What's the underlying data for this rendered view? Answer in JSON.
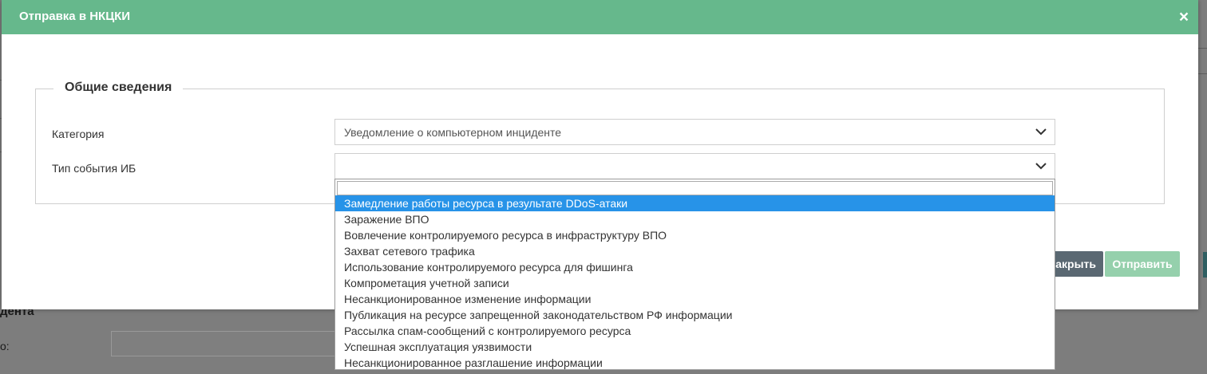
{
  "background": {
    "heading": "дента",
    "label": "о:"
  },
  "modal": {
    "title": "Отправка в НКЦКИ",
    "close_glyph": "×",
    "section_title": "Общие сведения",
    "fields": [
      {
        "label": "Категория",
        "value": "Уведомление о компьютерном инциденте"
      },
      {
        "label": "Тип события ИБ",
        "value": ""
      }
    ],
    "buttons": {
      "close_label": "Закрыть",
      "send_label": "Отправить"
    }
  },
  "dropdown": {
    "search_value": "",
    "highlighted_index": 0,
    "options": [
      "Замедление работы ресурса в результате DDoS-атаки",
      "Заражение ВПО",
      "Вовлечение контролируемого ресурса в инфраструктуру ВПО",
      "Захват сетевого трафика",
      "Использование контролируемого ресурса для фишинга",
      "Компрометация учетной записи",
      "Несанкционированное изменение информации",
      "Публикация на ресурсе запрещенной законодательством РФ информации",
      "Рассылка спам-сообщений с контролируемого ресурса",
      "Успешная эксплуатация уязвимости",
      "Несанкционированное разглашение информации"
    ]
  },
  "colors": {
    "header": "#66b88c",
    "highlight": "#2793e8",
    "send_button": "#95d0ac",
    "close_button": "#5a6872"
  }
}
